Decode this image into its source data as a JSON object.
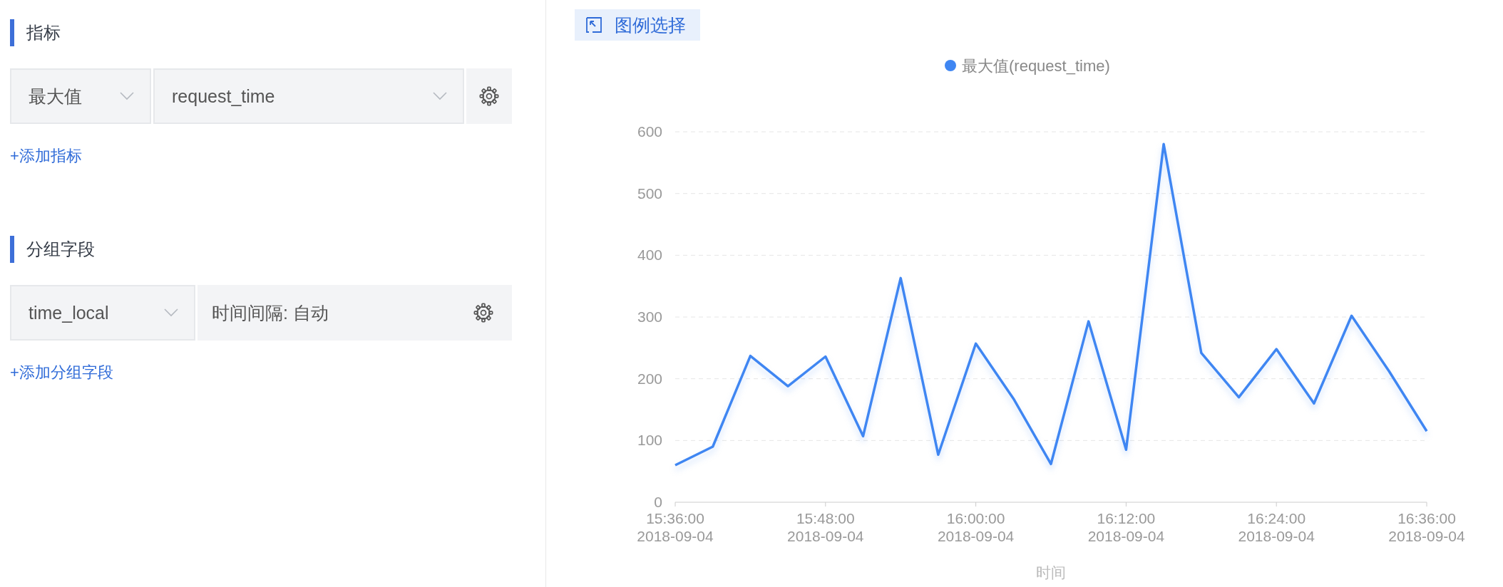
{
  "sections": [
    {
      "title": "指标",
      "row": {
        "kind": "metric",
        "select_1": "最大值",
        "select_2": "request_time"
      },
      "add_link": "+添加指标"
    },
    {
      "title": "分组字段",
      "row": {
        "kind": "group",
        "select_1": "time_local",
        "interval": "时间间隔: 自动"
      },
      "add_link": "+添加分组字段"
    }
  ],
  "legend_button": "图例选择",
  "chart": {
    "chart_data": {
      "type": "line",
      "xlabel": "时间",
      "categories": [
        "15:36:00 2018-09-04",
        null,
        null,
        null,
        "15:48:00 2018-09-04",
        null,
        null,
        null,
        "16:00:00 2018-09-04",
        null,
        null,
        null,
        "16:12:00 2018-09-04",
        null,
        null,
        null,
        "16:24:00 2018-09-04",
        null,
        null,
        null,
        "16:36:00 2018-09-04"
      ],
      "grid": true,
      "series": [
        {
          "name": "最大值(request_time)",
          "color": "#3f86f2",
          "values": [
            60,
            90,
            237,
            188,
            236,
            107,
            363,
            77,
            257,
            168,
            62,
            293,
            85,
            580,
            242,
            170,
            248,
            160,
            302,
            212,
            115
          ]
        }
      ],
      "ylim": [
        0,
        600
      ],
      "yticks": [
        0,
        100,
        200,
        300,
        400,
        500,
        600
      ]
    }
  }
}
